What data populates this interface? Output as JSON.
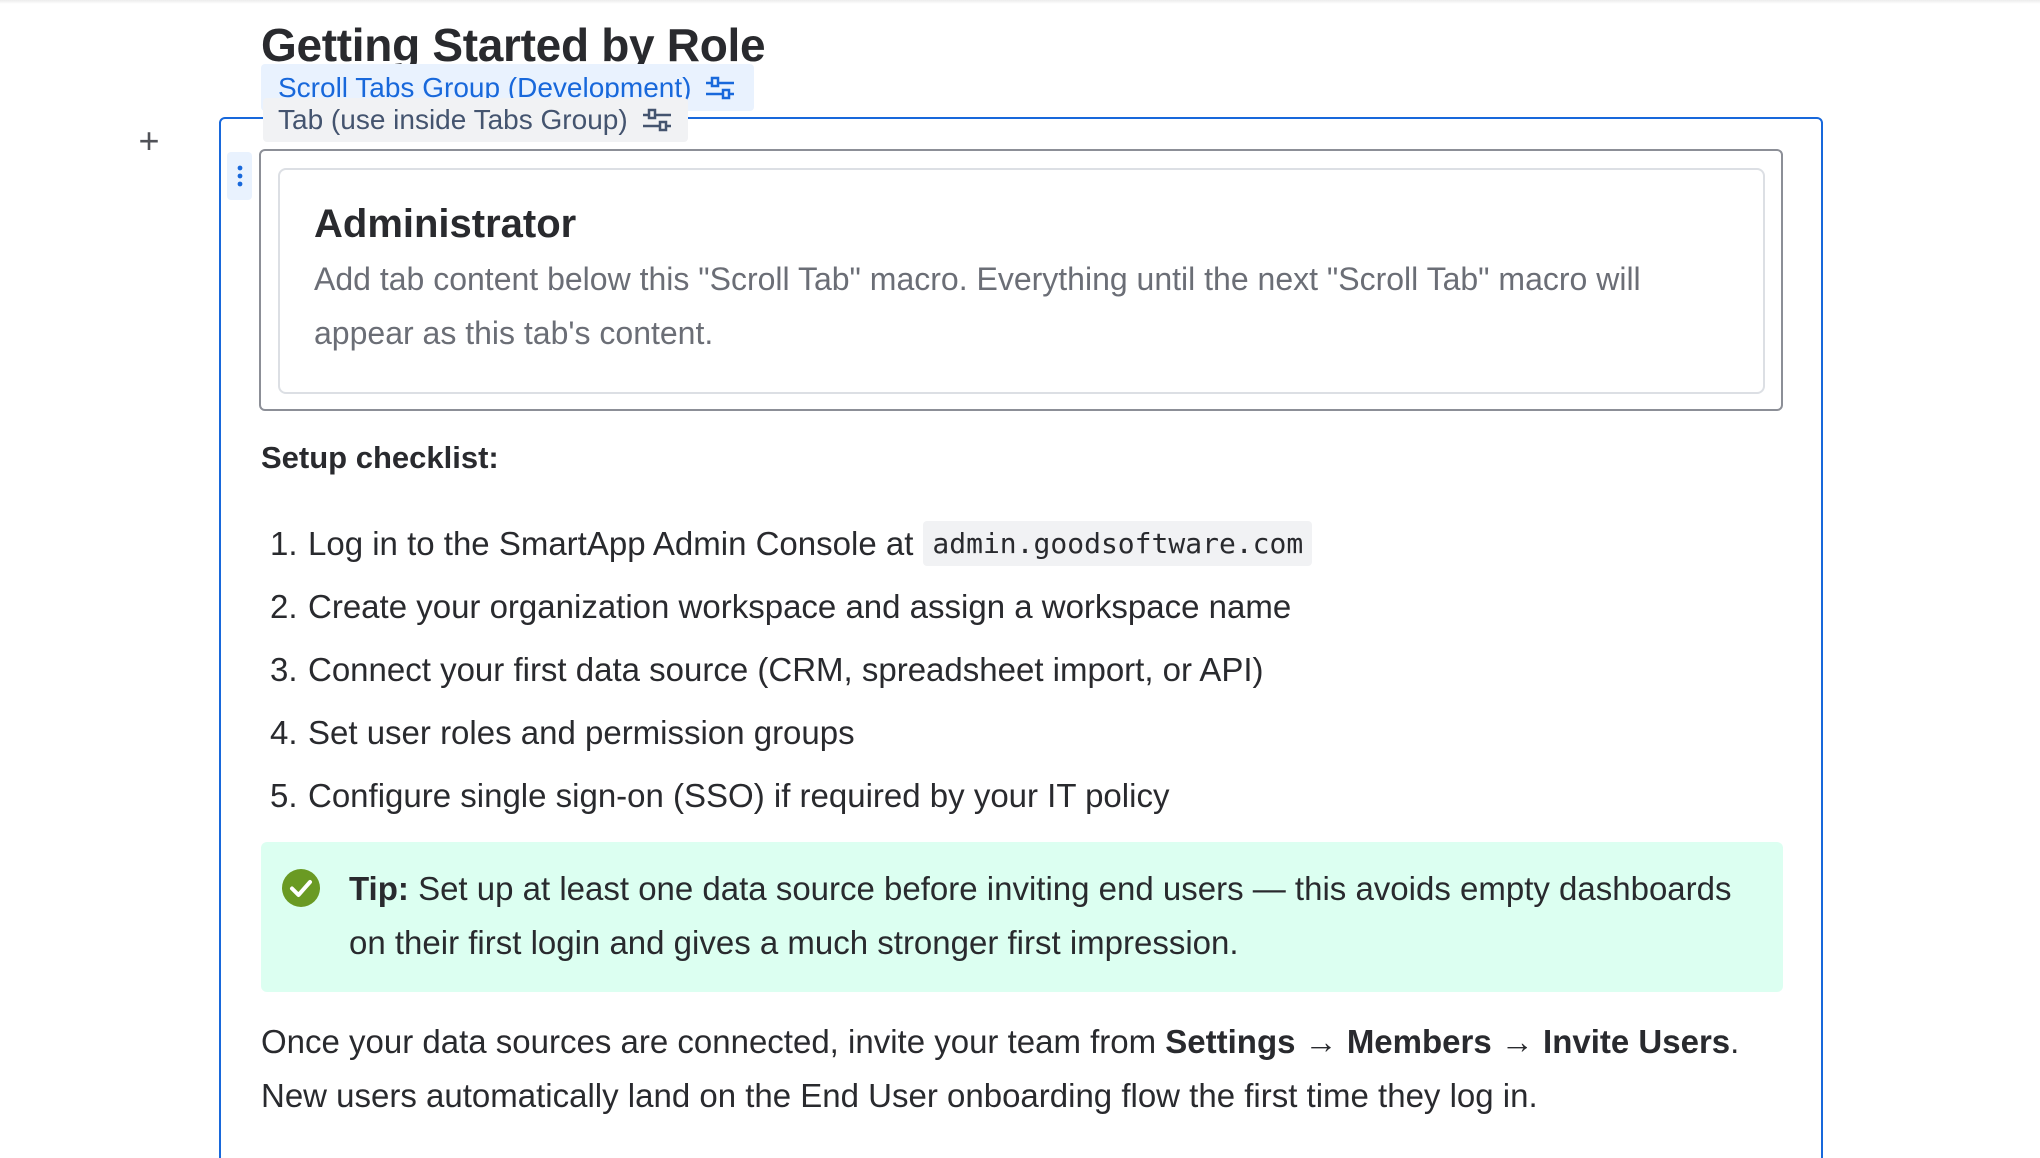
{
  "page": {
    "title": "Getting Started by Role"
  },
  "macros": {
    "group_label": "Scroll Tabs Group (Development)",
    "tab_label": "Tab (use inside Tabs Group)"
  },
  "tab": {
    "heading": "Administrator",
    "description": "Add tab content below this \"Scroll Tab\" macro. Everything until the next \"Scroll Tab\" macro will appear as this tab's content."
  },
  "checklist": {
    "label": "Setup checklist:",
    "items": [
      {
        "num": "1.",
        "text": "Log in to the SmartApp Admin Console at",
        "code": "admin.goodsoftware.com"
      },
      {
        "num": "2.",
        "text": "Create your organization workspace and assign a workspace name"
      },
      {
        "num": "3.",
        "text": "Connect your first data source (CRM, spreadsheet import, or API)"
      },
      {
        "num": "4.",
        "text": "Set user roles and permission groups"
      },
      {
        "num": "5.",
        "text": "Configure single sign-on (SSO) if required by your IT policy"
      }
    ]
  },
  "tip": {
    "label": "Tip:",
    "text": "Set up at least one data source before inviting end users — this avoids empty dashboards on their first login and gives a much stronger first impression."
  },
  "invite": {
    "intro": "Once your data sources are connected, invite your team from ",
    "path_settings": "Settings",
    "arrow": " → ",
    "path_members": "Members",
    "path_invite": "Invite Users",
    "period": ".",
    "followup": "New users automatically land on the End User onboarding flow the first time they log in."
  },
  "icons": {
    "macro_settings": "sliders-icon",
    "add": "plus-icon",
    "drag": "drag-handle-icon",
    "tip": "check-circle-icon"
  },
  "colors": {
    "accent": "#1868db",
    "tip_background": "#dcfff1",
    "tip_icon": "#6a9a23"
  }
}
